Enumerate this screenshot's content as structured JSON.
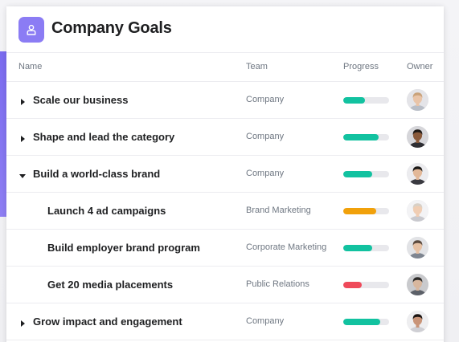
{
  "header": {
    "title": "Company Goals",
    "icon": "person-icon",
    "icon_color": "#8b7cf4"
  },
  "columns": {
    "name": "Name",
    "team": "Team",
    "progress": "Progress",
    "owner": "Owner"
  },
  "colors": {
    "green": "#12c2a0",
    "yellow": "#f1a10b",
    "red": "#ef4a5a",
    "track": "#e8e8ec",
    "accent_strip": "#7b6cf0"
  },
  "rows": [
    {
      "name": "Scale our business",
      "team": "Company",
      "progress": 0.48,
      "progress_color": "#12c2a0",
      "caret": "right",
      "indent": 0,
      "avatar": {
        "skin": "#e9c4a8",
        "hair": "#c9a27a",
        "shirt": "#b9bec7",
        "bg": "#e4e4e8"
      }
    },
    {
      "name": "Shape and lead the category",
      "team": "Company",
      "progress": 0.77,
      "progress_color": "#12c2a0",
      "caret": "right",
      "indent": 0,
      "avatar": {
        "skin": "#8a5a3b",
        "hair": "#1f1a17",
        "shirt": "#2e2e33",
        "bg": "#d6d6da"
      }
    },
    {
      "name": "Build a world-class brand",
      "team": "Company",
      "progress": 0.64,
      "progress_color": "#12c2a0",
      "caret": "down",
      "indent": 0,
      "avatar": {
        "skin": "#e2b898",
        "hair": "#1c1a18",
        "shirt": "#3a3a40",
        "bg": "#ececef"
      }
    },
    {
      "name": "Launch 4 ad campaigns",
      "team": "Brand Marketing",
      "progress": 0.72,
      "progress_color": "#f1a10b",
      "caret": "none",
      "indent": 1,
      "avatar": {
        "skin": "#f0cdb3",
        "hair": "#d8d0c6",
        "shirt": "#c9c9ce",
        "bg": "#f3f3f5"
      }
    },
    {
      "name": "Build employer brand program",
      "team": "Corporate Marketing",
      "progress": 0.64,
      "progress_color": "#12c2a0",
      "caret": "none",
      "indent": 1,
      "avatar": {
        "skin": "#e6c1a4",
        "hair": "#5b4a3e",
        "shirt": "#7e8590",
        "bg": "#e2e3e6"
      }
    },
    {
      "name": "Get 20 media placements",
      "team": "Public Relations",
      "progress": 0.4,
      "progress_color": "#ef4a5a",
      "caret": "none",
      "indent": 1,
      "avatar": {
        "skin": "#d8b79e",
        "hair": "#2c2a28",
        "shirt": "#5c6068",
        "bg": "#c9cacd"
      }
    },
    {
      "name": "Grow impact and engagement",
      "team": "Company",
      "progress": 0.8,
      "progress_color": "#12c2a0",
      "caret": "right",
      "indent": 0,
      "avatar": {
        "skin": "#c99478",
        "hair": "#1b1412",
        "shirt": "#cfcfd4",
        "bg": "#eeeef0"
      }
    }
  ]
}
